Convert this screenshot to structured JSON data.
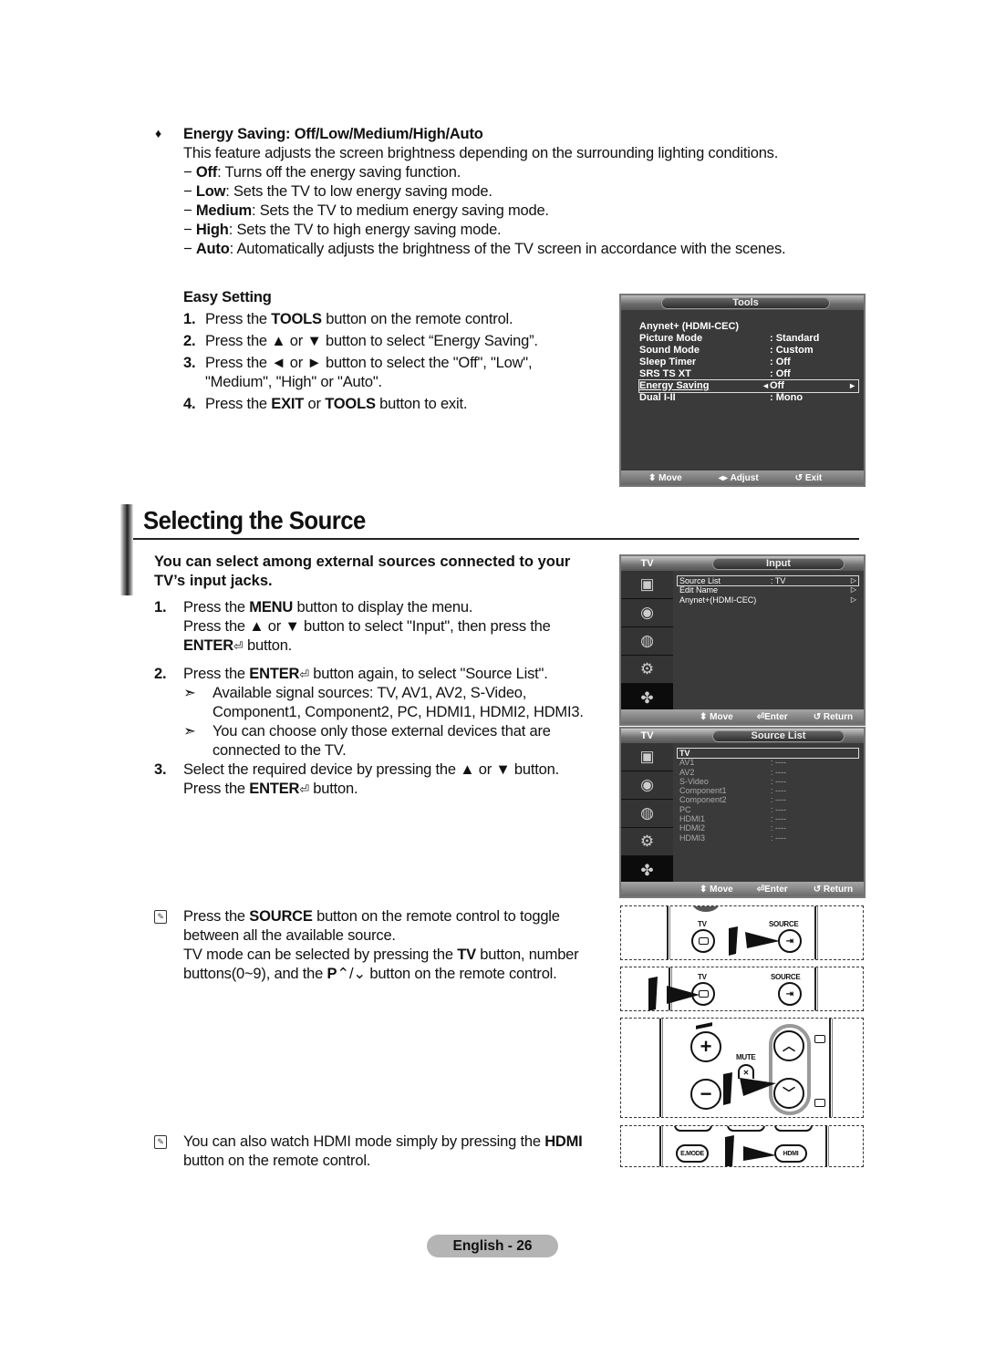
{
  "energy_saving": {
    "bullet": "♦",
    "title": "Energy Saving:  Off/Low/Medium/High/Auto",
    "description": "This feature adjusts the screen brightness depending on the surrounding lighting conditions.",
    "options": [
      {
        "dash": "−",
        "name": "Off",
        "text": ": Turns off the energy saving function."
      },
      {
        "dash": "−",
        "name": "Low",
        "text": ": Sets the TV to low energy saving mode."
      },
      {
        "dash": "−",
        "name": "Medium",
        "text": ": Sets the TV to medium energy saving mode."
      },
      {
        "dash": "−",
        "name": "High",
        "text": ": Sets the TV to high energy saving mode."
      },
      {
        "dash": "−",
        "name": "Auto",
        "text": ": Automatically adjusts the brightness of the TV screen in accordance with the scenes."
      }
    ]
  },
  "easy_setting": {
    "title": "Easy Setting",
    "steps": [
      {
        "num": "1.",
        "pre": "Press the ",
        "bold": "TOOLS",
        "post": " button on the remote control."
      },
      {
        "num": "2.",
        "pre": "Press the ▲ or ▼ button to select “Energy Saving”.",
        "bold": "",
        "post": ""
      },
      {
        "num": "3.",
        "pre": "Press the ◄ or ► button to select the \"Off\", \"Low\", \"Medium\", \"High\" or \"Auto\".",
        "bold": "",
        "post": ""
      },
      {
        "num": "4.",
        "pre": "Press the ",
        "bold": "EXIT",
        "mid": " or ",
        "bold2": "TOOLS",
        "post": " button to exit."
      }
    ]
  },
  "tools_osd": {
    "title": "Tools",
    "rows": [
      {
        "label": "Anynet+ (HDMI-CEC)",
        "value": ""
      },
      {
        "label": "Picture Mode",
        "value": ": Standard"
      },
      {
        "label": "Sound Mode",
        "value": ": Custom"
      },
      {
        "label": "Sleep Timer",
        "value": ": Off"
      },
      {
        "label": "SRS TS XT",
        "value": ": Off"
      },
      {
        "label": "Energy Saving",
        "value": "Off",
        "left_arrow": "◄",
        "right_arrow": "►"
      },
      {
        "label": "Dual I-II",
        "value": ": Mono"
      }
    ],
    "footer": {
      "move": "Move",
      "adjust": "Adjust",
      "exit": "Exit",
      "move_icon": "⬍",
      "adjust_icon": "◂▸",
      "exit_icon": "↺"
    }
  },
  "section": {
    "title": "Selecting the Source",
    "intro": "You can select among external sources connected to your TV’s input jacks.",
    "steps": {
      "s1_num": "1.",
      "s1_a_pre": "Press the ",
      "s1_a_bold": "MENU",
      "s1_a_post": " button to display the menu.",
      "s1_b": "Press the ▲ or ▼ button to select \"Input\", then press the",
      "s1_c_bold": "ENTER",
      "s1_c_post": " button.",
      "s2_num": "2.",
      "s2_pre": "Press the ",
      "s2_bold": "ENTER",
      "s2_post": " button again, to select \"Source List\".",
      "note_arrow": "➣",
      "note1": "Available signal sources:  TV, AV1, AV2, S-Video, Component1, Component2, PC, HDMI1, HDMI2, HDMI3.",
      "note2": "You can choose only those external devices that are connected to the TV.",
      "s3_num": "3.",
      "s3_a": "Select the required device by pressing the ▲ or ▼ button.",
      "s3_b_pre": "Press the ",
      "s3_b_bold": "ENTER",
      "s3_b_post": " button.",
      "enter_icon": "⏎"
    }
  },
  "input_osd": {
    "mode": "TV",
    "title": "Input",
    "rows": [
      {
        "label": "Source List",
        "value": ": TV",
        "arrow": "▷"
      },
      {
        "label": "Edit Name",
        "value": "",
        "arrow": "▷"
      },
      {
        "label": "Anynet+(HDMI-CEC)",
        "value": "",
        "arrow": "▷"
      }
    ],
    "footer": {
      "move": "Move",
      "enter": "Enter",
      "return": "Return",
      "move_icon": "⬍",
      "enter_icon": "⏎",
      "return_icon": "↺"
    }
  },
  "source_osd": {
    "mode": "TV",
    "title": "Source List",
    "rows": [
      {
        "label": "TV",
        "value": ""
      },
      {
        "label": "AV1",
        "value": ":  ----"
      },
      {
        "label": "AV2",
        "value": ":  ----"
      },
      {
        "label": "S-Video",
        "value": ":  ----"
      },
      {
        "label": "Component1",
        "value": ":  ----"
      },
      {
        "label": "Component2",
        "value": ":  ----"
      },
      {
        "label": "PC",
        "value": ":  ----"
      },
      {
        "label": "HDMI1",
        "value": ":  ----"
      },
      {
        "label": "HDMI2",
        "value": ":  ----"
      },
      {
        "label": "HDMI3",
        "value": ":  ----"
      }
    ],
    "footer": {
      "move": "Move",
      "enter": "Enter",
      "return": "Return",
      "move_icon": "⬍",
      "enter_icon": "⏎",
      "return_icon": "↺"
    }
  },
  "side_menu_icons": [
    "picture-icon",
    "sound-icon",
    "channel-icon",
    "setup-icon",
    "input-icon"
  ],
  "source_note": {
    "memo_icon": "✎",
    "a_pre": "Press the ",
    "a_bold": "SOURCE",
    "a_post": " button on the remote control to toggle between all the available source.",
    "b_pre": "TV mode can be selected by pressing the ",
    "b_bold": "TV",
    "b_mid": " button, number buttons(0~9), and the ",
    "b_bold2": "P",
    "b_sym": "⌃/⌄",
    "b_post": " button on the remote control."
  },
  "hdmi_note": {
    "memo_icon": "✎",
    "pre": "You can also watch HDMI mode simply by pressing the ",
    "bold": "HDMI",
    "post": " button on the remote control."
  },
  "remote": {
    "tv_label": "TV",
    "source_label": "SOURCE",
    "mute_label": "MUTE",
    "emode_label": "E.MODE",
    "hdmi_label": "HDMI",
    "plus": "+",
    "minus": "−",
    "up": "︿",
    "down": "﹀"
  },
  "footer": {
    "page_label": "English - 26"
  }
}
